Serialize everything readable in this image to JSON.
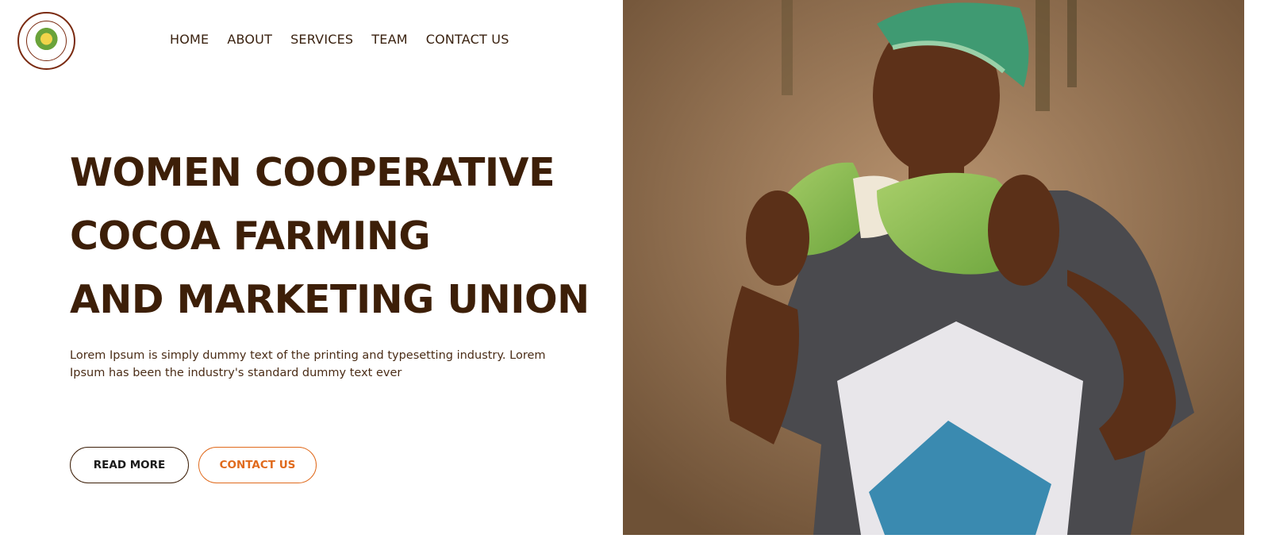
{
  "header": {
    "logo_name": "cooperative-logo",
    "nav": [
      {
        "label": "HOME"
      },
      {
        "label": "ABOUT"
      },
      {
        "label": "SERVICES"
      },
      {
        "label": "TEAM"
      },
      {
        "label": "CONTACT US"
      }
    ]
  },
  "hero": {
    "title_lines": [
      "WOMEN COOPERATIVE",
      "COCOA FARMING",
      "AND MARKETING UNION"
    ],
    "description": "Lorem Ipsum is simply dummy text of the printing and typesetting industry. Lorem Ipsum has been the industry's standard dummy text ever",
    "read_more_label": "READ MORE",
    "contact_label": "CONTACT US"
  },
  "colors": {
    "title": "#3d1f08",
    "accent": "#e06a1c"
  }
}
